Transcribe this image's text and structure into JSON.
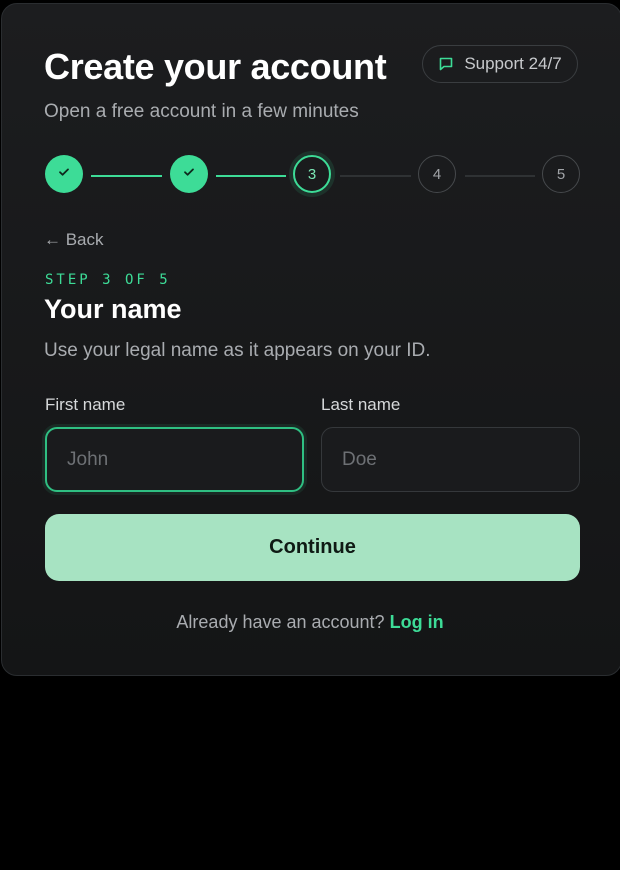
{
  "header": {
    "title": "Create your account",
    "subtitle": "Open a free account in a few minutes",
    "support_label": "Support 24/7",
    "support_icon": "chat-icon"
  },
  "stepper": {
    "steps": [
      {
        "label": "1",
        "status": "completed",
        "icon": "check-icon"
      },
      {
        "label": "2",
        "status": "completed",
        "icon": "check-icon"
      },
      {
        "label": "3",
        "status": "current"
      },
      {
        "label": "4",
        "status": "upcoming"
      },
      {
        "label": "5",
        "status": "upcoming"
      }
    ]
  },
  "nav": {
    "back_label": "← Back"
  },
  "section": {
    "eyebrow": "STEP 3 OF 5",
    "title": "Your name",
    "description": "Use your legal name as it appears on your ID."
  },
  "form": {
    "first_name": {
      "label": "First name",
      "placeholder": "John",
      "value": ""
    },
    "last_name": {
      "label": "Last name",
      "placeholder": "Doe",
      "value": ""
    },
    "submit_label": "Continue"
  },
  "footer": {
    "prompt": "Already have an account?",
    "link_label": "Log in"
  },
  "colors": {
    "accent": "#3ddc97",
    "button_bg": "#a7e3c2",
    "card_bg": "#1a1b1d",
    "page_bg": "#000000"
  }
}
